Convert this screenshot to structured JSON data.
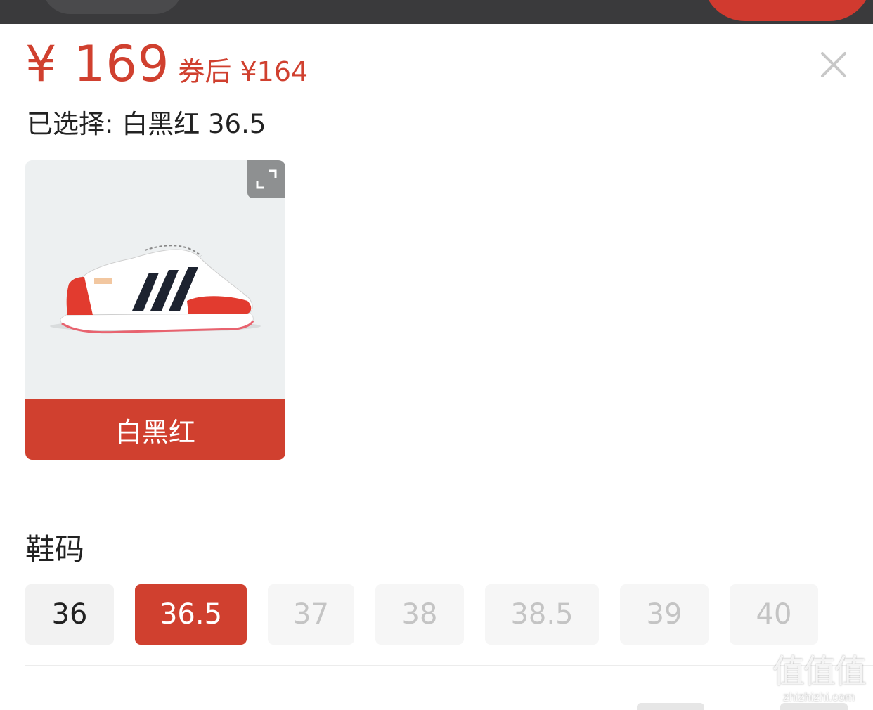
{
  "price": {
    "current": "¥ 169",
    "coupon": "券后 ¥164"
  },
  "selection": {
    "text": "已选择: 白黑红 36.5"
  },
  "color_option": {
    "label": "白黑红",
    "selected": true
  },
  "size_section": {
    "title": "鞋码",
    "options": [
      {
        "label": "36",
        "state": "available"
      },
      {
        "label": "36.5",
        "state": "selected"
      },
      {
        "label": "37",
        "state": "disabled"
      },
      {
        "label": "38",
        "state": "disabled"
      },
      {
        "label": "38.5",
        "state": "disabled"
      },
      {
        "label": "39",
        "state": "disabled"
      },
      {
        "label": "40",
        "state": "disabled"
      }
    ]
  },
  "watermark": {
    "logo": "值值值",
    "site": "zhizhizhi.com"
  },
  "colors": {
    "accent": "#d0402f",
    "text": "#222222",
    "disabled_text": "#c4c4c4",
    "chip_bg": "#f2f2f2"
  },
  "icons": {
    "close": "close-icon",
    "expand": "expand-icon"
  }
}
